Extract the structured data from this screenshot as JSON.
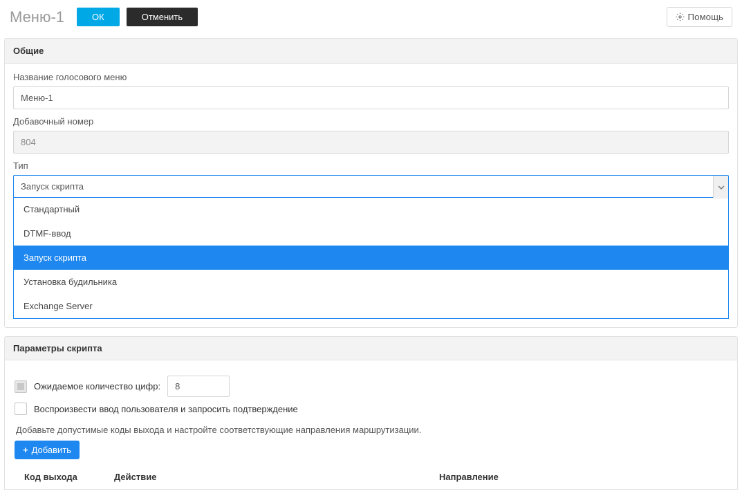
{
  "header": {
    "title": "Меню-1",
    "ok_label": "ОК",
    "cancel_label": "Отменить",
    "help_label": "Помощь"
  },
  "general": {
    "section_title": "Общие",
    "name_label": "Название голосового меню",
    "name_value": "Меню-1",
    "ext_label": "Добавочный номер",
    "ext_value": "804",
    "type_label": "Тип",
    "type_selected": "Запуск скрипта",
    "type_options": [
      "Стандартный",
      "DTMF-ввод",
      "Запуск скрипта",
      "Установка будильника",
      "Exchange Server"
    ]
  },
  "script_params": {
    "section_title": "Параметры скрипта",
    "expected_digits_label": "Ожидаемое количество цифр:",
    "expected_digits_value": "8",
    "playback_confirm_label": "Воспроизвести ввод пользователя и запросить подтверждение",
    "help_text": "Добавьте допустимые коды выхода и настройте соответствующие направления маршрутизации.",
    "add_label": "Добавить",
    "columns": {
      "exit": "Код выхода",
      "action": "Действие",
      "destination": "Направление"
    }
  }
}
